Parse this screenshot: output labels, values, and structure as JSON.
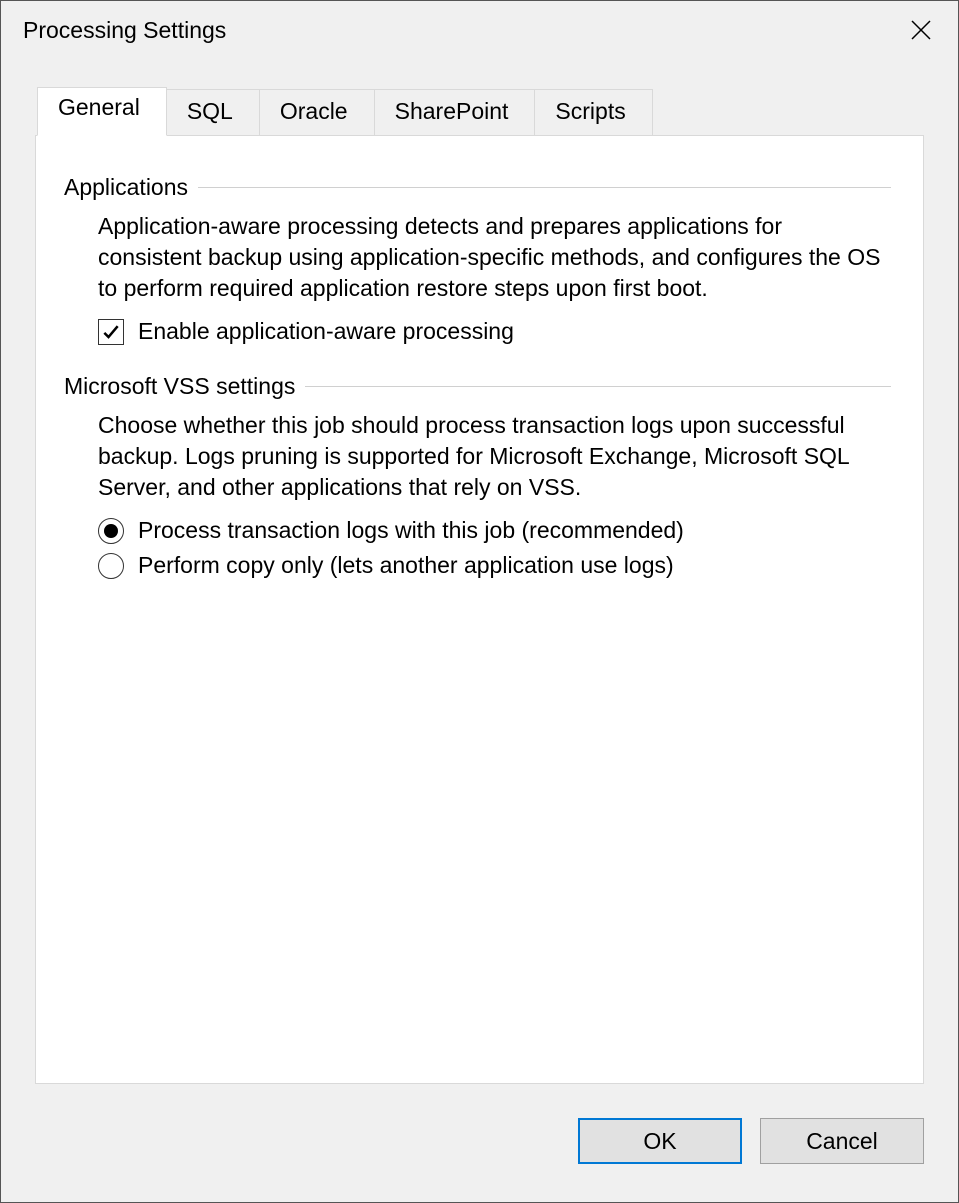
{
  "title": "Processing Settings",
  "tabs": [
    {
      "label": "General",
      "active": true
    },
    {
      "label": "SQL",
      "active": false
    },
    {
      "label": "Oracle",
      "active": false
    },
    {
      "label": "SharePoint",
      "active": false
    },
    {
      "label": "Scripts",
      "active": false
    }
  ],
  "sections": {
    "applications": {
      "title": "Applications",
      "desc": "Application-aware processing detects and prepares applications for consistent backup using application-specific methods, and configures the OS to perform required application restore steps upon first boot.",
      "checkbox": {
        "label": "Enable application-aware processing",
        "checked": true
      }
    },
    "vss": {
      "title": "Microsoft VSS settings",
      "desc": "Choose whether this job should process transaction logs upon successful backup. Logs pruning is supported for Microsoft Exchange, Microsoft SQL Server, and other applications that rely on VSS.",
      "radios": [
        {
          "label": "Process transaction logs with this job (recommended)",
          "selected": true
        },
        {
          "label": "Perform copy only (lets another application use logs)",
          "selected": false
        }
      ]
    }
  },
  "footer": {
    "ok": "OK",
    "cancel": "Cancel"
  }
}
